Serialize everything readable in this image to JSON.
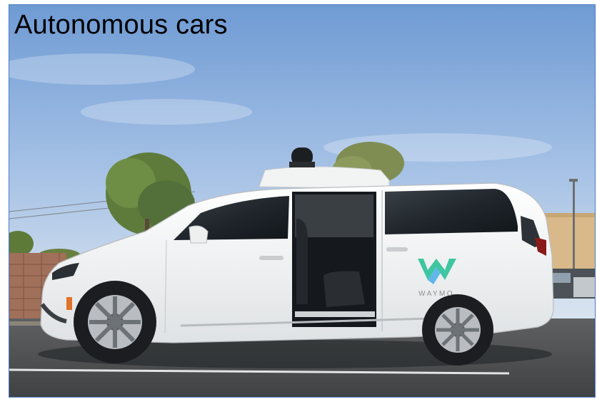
{
  "slide": {
    "title": "Autonomous cars"
  },
  "photo": {
    "brand_text": "WAYMO",
    "brand_colors": {
      "left": "#3ddc97",
      "mid": "#5fb8e8",
      "right": "#2fa6c7"
    },
    "sky_color": "#7fa6d8",
    "car_color": "#f4f5f4"
  }
}
